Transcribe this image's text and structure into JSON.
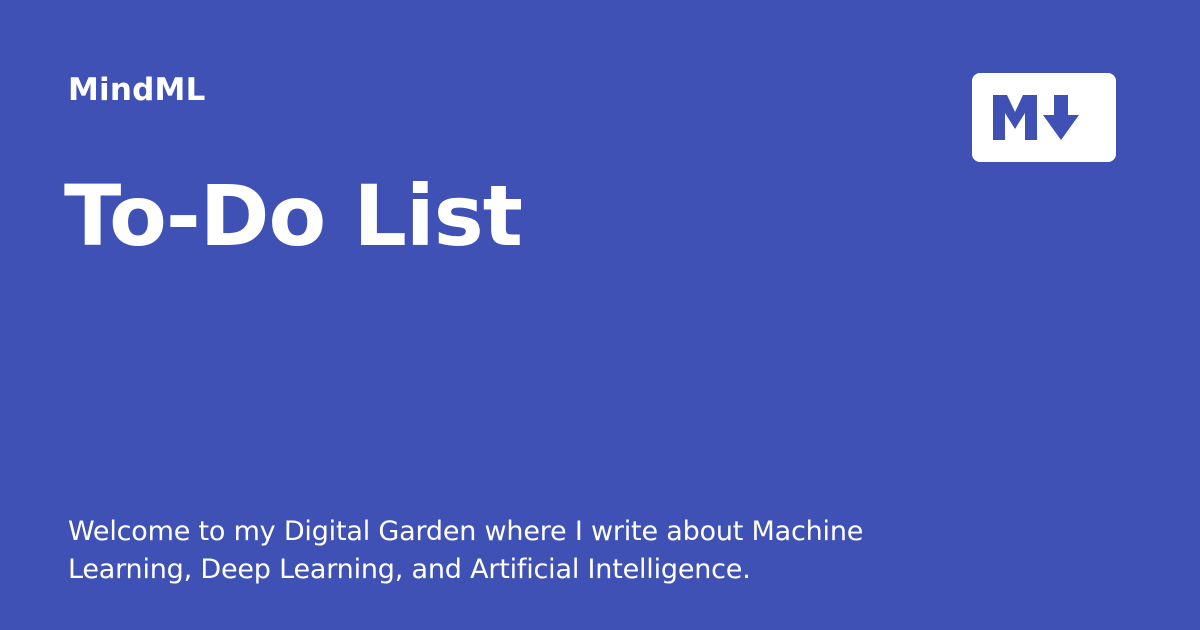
{
  "site": {
    "name": "MindML"
  },
  "page": {
    "title": "To-Do List",
    "description": "Welcome to my Digital Garden where I write about Machine Learning, Deep Learning, and Artificial Intelligence."
  },
  "badge": {
    "icon": "markdown-icon"
  },
  "colors": {
    "background": "#3f51b5",
    "text": "#ffffff",
    "badge_background": "#ffffff"
  }
}
